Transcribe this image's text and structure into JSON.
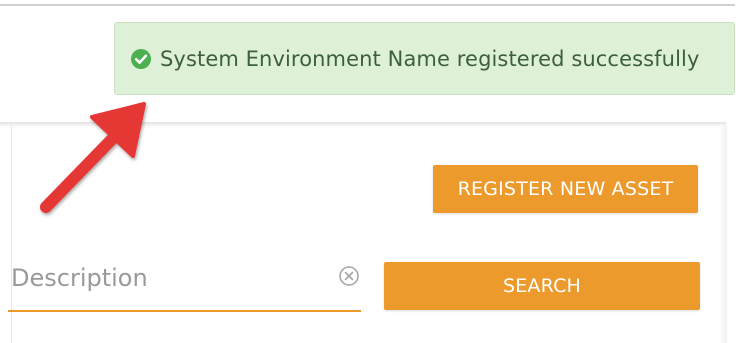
{
  "notification": {
    "message": "System Environment Name registered successfully",
    "icon": "check-circle-icon",
    "status_color": "#4caf50"
  },
  "actions": {
    "register_label": "REGISTER NEW ASSET",
    "search_label": "SEARCH"
  },
  "search": {
    "placeholder": "Description",
    "value": "",
    "clear_icon": "clear-circle-icon"
  },
  "theme": {
    "accent": "#ed9a2c",
    "success_bg": "#dff0d8",
    "annotation_arrow": "#e53935"
  }
}
